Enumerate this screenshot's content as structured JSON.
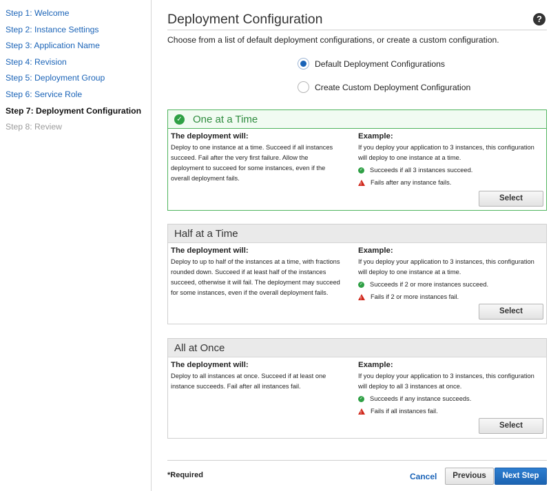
{
  "sidebar": {
    "steps": [
      {
        "label": "Step 1: Welcome"
      },
      {
        "label": "Step 2: Instance Settings"
      },
      {
        "label": "Step 3: Application Name"
      },
      {
        "label": "Step 4: Revision"
      },
      {
        "label": "Step 5: Deployment Group"
      },
      {
        "label": "Step 6: Service Role"
      },
      {
        "label": "Step 7: Deployment Configuration"
      },
      {
        "label": "Step 8: Review"
      }
    ]
  },
  "main": {
    "title": "Deployment Configuration",
    "help_icon": "?",
    "subtitle": "Choose from a list of default deployment configurations, or create a custom configuration.",
    "radios": [
      {
        "label": "Default Deployment Configurations",
        "checked": true
      },
      {
        "label": "Create Custom Deployment Configuration",
        "checked": false
      }
    ]
  },
  "cards": [
    {
      "title": "One at a Time",
      "left_title": "The deployment will:",
      "left_text": "Deploy to one instance at a time. Succeed if all instances succeed. Fail after the very first failure. Allow the deployment to succeed for some instances, even if the overall deployment fails.",
      "right_title": "Example:",
      "right_text": "If you deploy your application to 3 instances, this configuration will deploy to one instance at a time.",
      "success": "Succeeds if all 3 instances succeed.",
      "failure": "Fails after any instance fails.",
      "button": "Select"
    },
    {
      "title": "Half at a Time",
      "left_title": "The deployment will:",
      "left_text": "Deploy to up to half of the instances at a time, with fractions rounded down. Succeed if at least half of the instances succeed, otherwise it will fail. The deployment may succeed for some instances, even if the overall deployment fails.",
      "right_title": "Example:",
      "right_text": "If you deploy your application to 3 instances, this configuration will deploy to one instance at a time.",
      "success": "Succeeds if 2 or more instances succeed.",
      "failure": "Fails if 2 or more instances fail.",
      "button": "Select"
    },
    {
      "title": "All at Once",
      "left_title": "The deployment will:",
      "left_text": "Deploy to all instances at once. Succeed if at least one instance succeeds. Fail after all instances fail.",
      "right_title": "Example:",
      "right_text": "If you deploy your application to 3 instances, this configuration will deploy to all 3 instances at once.",
      "success": "Succeeds if any instance succeeds.",
      "failure": "Fails if all instances fail.",
      "button": "Select"
    }
  ],
  "footer": {
    "required": "*Required",
    "cancel": "Cancel",
    "previous": "Previous",
    "next": "Next Step"
  },
  "colors": {
    "link": "#1a63b7",
    "selected_border": "#4eb35c",
    "primary_button": "#1c64b2",
    "success_icon": "#2fa045",
    "warning_icon": "#d0281c"
  }
}
